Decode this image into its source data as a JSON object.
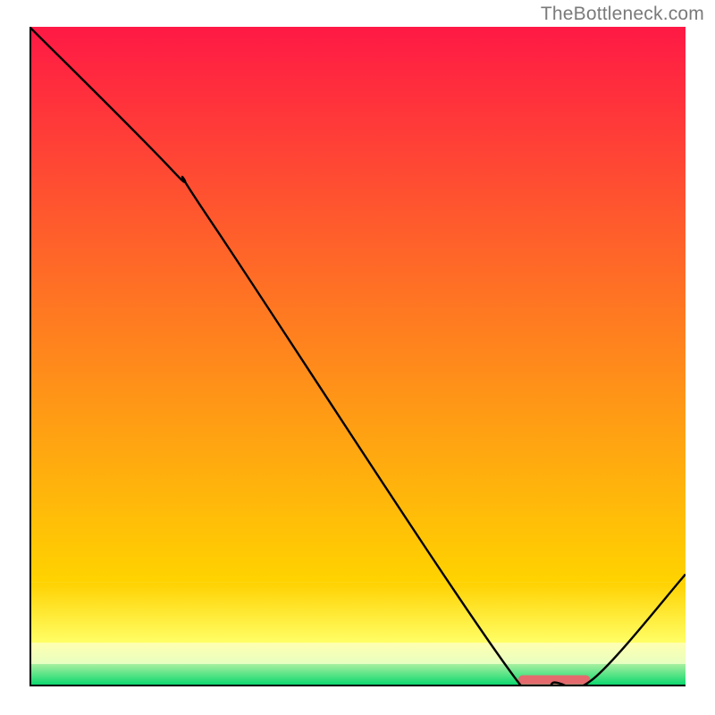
{
  "watermark": "TheBottleneck.com",
  "plot": {
    "width_u": 100,
    "height_u": 100,
    "axis_stroke": "#000000",
    "axis_width": 0.55,
    "curve_stroke": "#000000",
    "curve_width": 0.35,
    "background_bands": [
      {
        "y0": 0,
        "y1": 84.2,
        "c0": "#ff1945",
        "c1": "#ffd300"
      },
      {
        "y0": 84.2,
        "y1": 93.4,
        "c0": "#ffd100",
        "c1": "#ffff66"
      },
      {
        "y0": 93.4,
        "y1": 96.6,
        "c0": "#ffffb0",
        "c1": "#e8ffc0"
      },
      {
        "y0": 96.6,
        "y1": 100,
        "c0": "#a8f0a0",
        "c1": "#00d76a"
      }
    ],
    "marker": {
      "x0": 74.5,
      "x1": 85.5,
      "y": 99.0,
      "height": 1.4,
      "fill": "#e46a6e",
      "rx": 0.7
    }
  },
  "chart_data": {
    "type": "line",
    "title": "",
    "xlabel": "",
    "ylabel": "",
    "xlim": [
      0,
      100
    ],
    "ylim": [
      0,
      100
    ],
    "note": "Axes carry no visible tick labels; values below are positions in the 0–100 plot coordinate space read from the figure.",
    "series": [
      {
        "name": "curve",
        "points": [
          {
            "x": 0,
            "y": 100
          },
          {
            "x": 22,
            "y": 78
          },
          {
            "x": 28,
            "y": 70
          },
          {
            "x": 74,
            "y": 1.3
          },
          {
            "x": 80,
            "y": 0.6
          },
          {
            "x": 86,
            "y": 1.2
          },
          {
            "x": 100,
            "y": 17
          }
        ]
      }
    ],
    "highlight_range_x": [
      74.5,
      85.5
    ]
  }
}
